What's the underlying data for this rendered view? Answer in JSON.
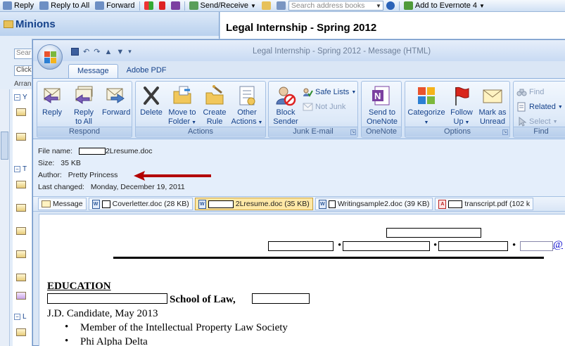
{
  "bg_toolbar": {
    "reply": "Reply",
    "reply_all": "Reply to All",
    "forward": "Forward",
    "send_receive": "Send/Receive",
    "search_placeholder": "Search address books",
    "evernote": "Add to Evernote 4"
  },
  "bg_left": {
    "folder_title": "Minions",
    "search_stub": "Sear",
    "click_stub": "Click",
    "arrange_stub": "Arran",
    "groups": [
      "Y",
      "T",
      "L"
    ]
  },
  "bg_reading": {
    "subject": "Legal Internship - Spring 2012"
  },
  "window": {
    "title": "Legal Internship - Spring 2012 - Message (HTML)",
    "tabs": [
      "Message",
      "Adobe PDF"
    ],
    "groups": {
      "respond": "Respond",
      "actions": "Actions",
      "junk": "Junk E-mail",
      "onenote": "OneNote",
      "options": "Options",
      "find": "Find"
    },
    "buttons": {
      "reply": "Reply",
      "reply_all_1": "Reply",
      "reply_all_2": "to All",
      "forward": "Forward",
      "delete": "Delete",
      "move_1": "Move to",
      "move_2": "Folder",
      "rule_1": "Create",
      "rule_2": "Rule",
      "other_1": "Other",
      "other_2": "Actions",
      "block_1": "Block",
      "block_2": "Sender",
      "safe_lists": "Safe Lists",
      "not_junk": "Not Junk",
      "send_on_1": "Send to",
      "send_on_2": "OneNote",
      "categorize": "Categorize",
      "follow_1": "Follow",
      "follow_2": "Up",
      "unread_1": "Mark as",
      "unread_2": "Unread",
      "find": "Find",
      "related": "Related",
      "select": "Select"
    }
  },
  "meta": {
    "file_name_label": "File name:",
    "file_name_value": "2Lresume.doc",
    "size_label": "Size:",
    "size_value": "35 KB",
    "author_label": "Author:",
    "author_value": "Pretty Princess",
    "changed_label": "Last changed:",
    "changed_value": "Monday, December 19, 2011"
  },
  "attachments": [
    {
      "name": "Message"
    },
    {
      "name": "Coverletter.doc (28 KB)"
    },
    {
      "name": "2Lresume.doc (35 KB)"
    },
    {
      "name": "Writingsample2.doc (39 KB)"
    },
    {
      "name": "transcript.pdf (102 k"
    }
  ],
  "document": {
    "email_stub": "@",
    "bullet_sep": "•",
    "education_heading": "EDUCATION",
    "school_suffix": "School of Law,",
    "degree": "J.D. Candidate, May 2013",
    "bullets": [
      "Member of the Intellectual Property Law Society",
      "Phi Alpha Delta"
    ]
  },
  "colors": {
    "arrow": "#b30000",
    "ribbon_text": "#15428b"
  }
}
